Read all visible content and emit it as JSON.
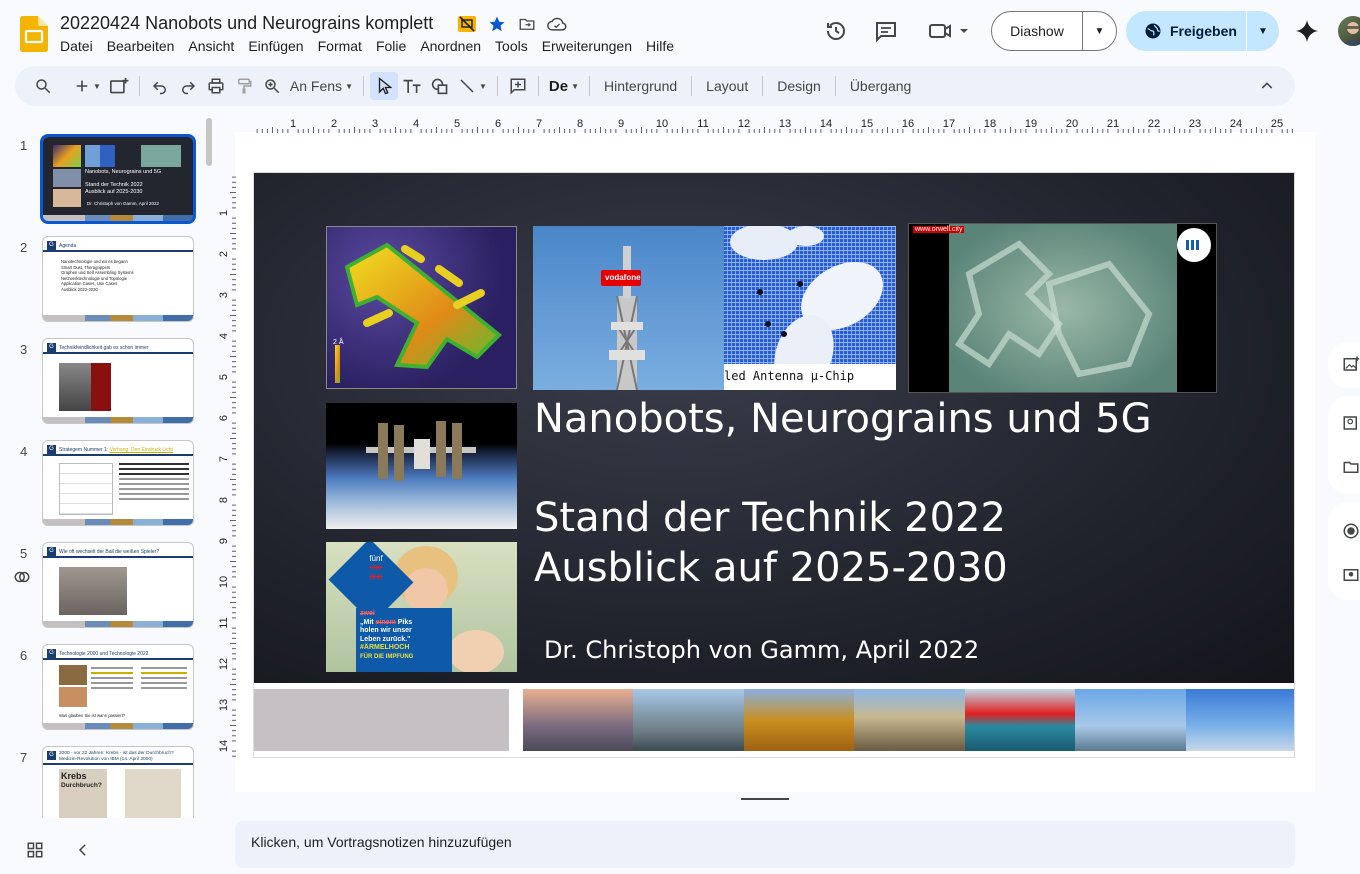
{
  "document": {
    "title": "20220424 Nanobots und Neurograins komplett"
  },
  "menu": [
    "Datei",
    "Bearbeiten",
    "Ansicht",
    "Einfügen",
    "Format",
    "Folie",
    "Anordnen",
    "Tools",
    "Erweiterungen",
    "Hilfe"
  ],
  "header": {
    "slideshow_label": "Diashow",
    "share_label": "Freigeben"
  },
  "toolbar": {
    "zoom_label": "An Fens",
    "background_label": "Hintergrund",
    "layout_label": "Layout",
    "design_label": "Design",
    "transition_label": "Übergang"
  },
  "ruler": {
    "top": [
      "1",
      "2",
      "3",
      "4",
      "5",
      "6",
      "7",
      "8",
      "9",
      "10",
      "11",
      "12",
      "13",
      "14",
      "15",
      "16",
      "17",
      "18",
      "19",
      "20",
      "21",
      "22",
      "23",
      "24",
      "25"
    ],
    "left": [
      "1",
      "2",
      "3",
      "4",
      "5",
      "6",
      "7",
      "8",
      "9",
      "10",
      "11",
      "12",
      "13",
      "14"
    ]
  },
  "filmstrip": [
    {
      "num": "1",
      "title": "Nanobots, Neurograins und 5G",
      "sub1": "Stand der Technik 2022",
      "sub2": "Ausblick auf 2025-2030",
      "author": "Dr. Christoph von Gamm, April 2022"
    },
    {
      "num": "2",
      "title": "Agenda",
      "items": [
        "Nanotechnologie und wo es begann",
        "Smart Dust, Theragrippers",
        "Graphen und Self Assembling Systems",
        "Netzwerktechnologie und Topologie",
        "Application Cases, Use Cases",
        "Ausblick 2022-2030"
      ]
    },
    {
      "num": "3",
      "title": "Technikfeindlichkeit gab es schon immer"
    },
    {
      "num": "4",
      "title": "Strategem Nummer 1:",
      "highlight": "Vorhang: Den Eindruck Licht"
    },
    {
      "num": "5",
      "title": "Wie oft wechselt der Ball die weißen Spieler?"
    },
    {
      "num": "6",
      "title": "Technologie 2000 und Technologie 2022",
      "footer": "Was glauben Sie ist wann passiert?"
    },
    {
      "num": "7",
      "title": "2000 - vor 22 Jahren: Krebs - ist das der Durchbruch?",
      "sub": "Medizin-Revolution von IBM (14. April 2000)",
      "clip1": "Krebs",
      "clip2": "Durchbruch?"
    }
  ],
  "slide": {
    "title": "Nanobots, Neurograins und 5G",
    "subtitle_line1": "Stand der Technik 2022",
    "subtitle_line2": "Ausblick auf 2025-2030",
    "author": "Dr. Christoph von Gamm, April 2022",
    "image_tower_brand": "vodafone",
    "image_chip_caption": "led Antenna μ-Chip",
    "image_video_url": "www.orwell.city",
    "image_scale_label": "2 Å",
    "image_poster_line1": "fünf",
    "image_poster_strike1": "vier",
    "image_poster_strike2": "drei",
    "image_poster_strike3": "zwei",
    "image_poster_line2_a": "„Mit",
    "image_poster_line2_strike": "einem",
    "image_poster_line2_b": "Piks",
    "image_poster_line3": "holen wir unser",
    "image_poster_line4": "Leben zurück.\"",
    "image_poster_tag1": "#ÄRMELHOCH",
    "image_poster_tag2": "FÜR DIE IMPFUNG"
  },
  "notes": {
    "placeholder": "Klicken, um Vortragsnotizen hinzuzufügen"
  },
  "colors": {
    "accent": "#0b57d0",
    "share_bg": "#c2e7ff",
    "toolbar_bg": "#edf2fa",
    "slide_bg": "#23252f"
  }
}
